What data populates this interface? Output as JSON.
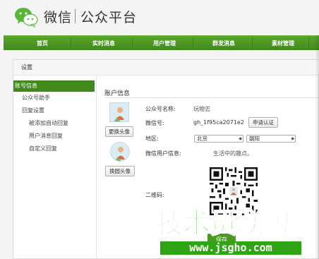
{
  "header": {
    "brand": "微信",
    "subtitle": "公众平台"
  },
  "nav": [
    "首页",
    "实时消息",
    "用户管理",
    "群发消息",
    "素材管理"
  ],
  "panel": {
    "title": "设置"
  },
  "sidebar": {
    "items": [
      {
        "label": "账号信息",
        "active": true,
        "indent": false
      },
      {
        "label": "公众号助手",
        "active": false,
        "indent": false
      },
      {
        "label": "回复设置",
        "active": false,
        "indent": false
      },
      {
        "label": "被添加自动回复",
        "active": false,
        "indent": true
      },
      {
        "label": "用户消息回复",
        "active": false,
        "indent": true
      },
      {
        "label": "自定义回复",
        "active": false,
        "indent": true
      }
    ]
  },
  "account": {
    "section_title": "账户信息",
    "change_avatar_btn": "更换头像",
    "change_cover_btn": "换圆头像",
    "name_label": "公众号名称:",
    "name_value": "玩物志",
    "wechat_id_label": "微信号:",
    "wechat_id_value": "gh_1f95ca2071e2",
    "verify_btn": "申请认证",
    "region_label": "地区:",
    "region_province": "北京",
    "region_city": "朝阳",
    "intro_label": "微信用户信息:",
    "intro_value": "生活中的趣点。",
    "qrcode_label": "二维码:",
    "save_btn": "保存"
  },
  "watermark": {
    "text_cn": "技术员联盟",
    "url": "www.jsgho.com"
  },
  "colors": {
    "nav_green": "#4a9a22",
    "watermark_green": "#36c21a"
  }
}
